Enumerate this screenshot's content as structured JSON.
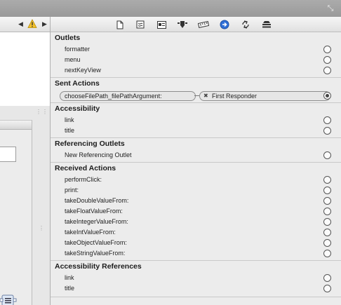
{
  "toolbar": {
    "icons": [
      "file-inspector-icon",
      "quick-help-icon",
      "identity-inspector-icon",
      "attributes-inspector-icon",
      "size-inspector-icon",
      "connections-inspector-icon",
      "bindings-inspector-icon",
      "effects-inspector-icon"
    ],
    "selected": "connections-inspector-icon",
    "accent": "#2f6fd6"
  },
  "canvas": {
    "nav_left": "◀",
    "nav_right": "▶"
  },
  "sections": {
    "outlets": {
      "title": "Outlets",
      "items": [
        "formatter",
        "menu",
        "nextKeyView"
      ]
    },
    "sent_actions": {
      "title": "Sent Actions",
      "source": "chooseFilePath_filePathArgument:",
      "target": "First Responder",
      "remove": "✖"
    },
    "accessibility": {
      "title": "Accessibility",
      "items": [
        "link",
        "title"
      ]
    },
    "referencing_outlets": {
      "title": "Referencing Outlets",
      "items": [
        "New Referencing Outlet"
      ]
    },
    "received_actions": {
      "title": "Received Actions",
      "items": [
        "performClick:",
        "print:",
        "takeDoubleValueFrom:",
        "takeFloatValueFrom:",
        "takeIntegerValueFrom:",
        "takeIntValueFrom:",
        "takeObjectValueFrom:",
        "takeStringValueFrom:"
      ]
    },
    "accessibility_references": {
      "title": "Accessibility References",
      "items": [
        "link",
        "title"
      ]
    }
  }
}
